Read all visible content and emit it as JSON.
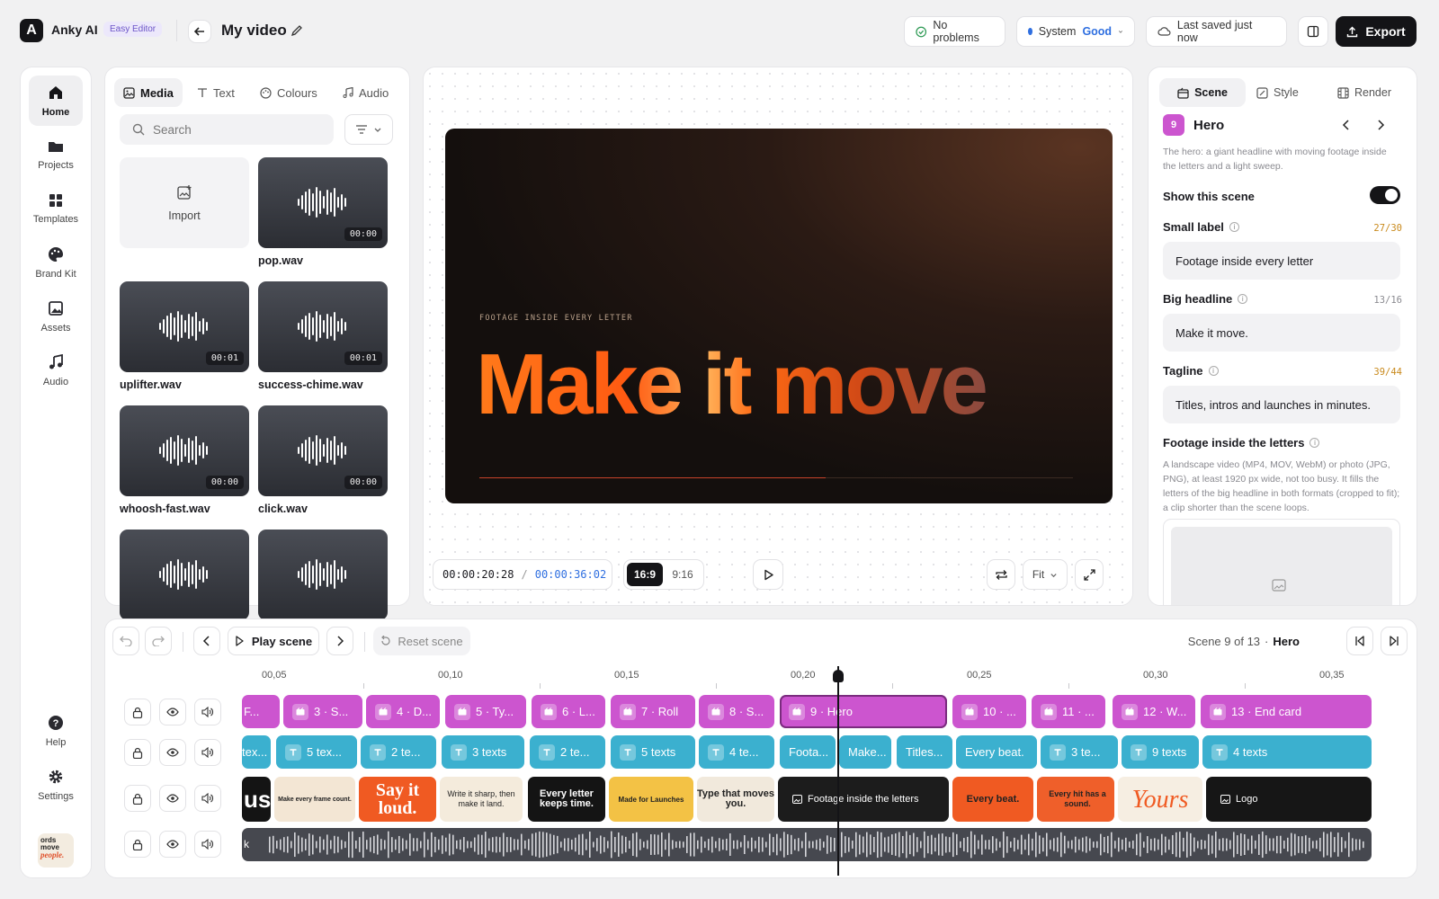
{
  "header": {
    "app_name": "Anky AI",
    "mode_badge": "Easy Editor",
    "video_title": "My video",
    "problems": "No problems",
    "system_label": "System",
    "system_status": "Good",
    "saved": "Last saved just now",
    "export": "Export",
    "accent": "#141417"
  },
  "sidebar": {
    "items": [
      {
        "label": "Home",
        "icon": "home-icon"
      },
      {
        "label": "Projects",
        "icon": "folder-icon"
      },
      {
        "label": "Templates",
        "icon": "grid-icon"
      },
      {
        "label": "Brand Kit",
        "icon": "palette-icon"
      },
      {
        "label": "Assets",
        "icon": "image-icon"
      },
      {
        "label": "Audio",
        "icon": "music-icon"
      }
    ],
    "help": "Help",
    "settings": "Settings",
    "avatar_text": [
      "ords",
      "move",
      "people."
    ]
  },
  "media": {
    "tabs": [
      "Media",
      "Text",
      "Colours",
      "Audio"
    ],
    "search_placeholder": "Search",
    "import": "Import",
    "files": [
      {
        "name": "pop.wav",
        "duration": "00:00"
      },
      {
        "name": "uplifter.wav",
        "duration": "00:01"
      },
      {
        "name": "success-chime.wav",
        "duration": "00:01"
      },
      {
        "name": "whoosh-fast.wav",
        "duration": "00:00"
      },
      {
        "name": "click.wav",
        "duration": "00:00"
      }
    ]
  },
  "preview": {
    "small_label": "FOOTAGE INSIDE EVERY LETTER",
    "headline": "Make it move",
    "current_time": "00:00:20:28",
    "total_time": "00:00:36:02",
    "ratios": [
      "16:9",
      "9:16"
    ],
    "fit": "Fit"
  },
  "inspector": {
    "tabs": [
      "Scene",
      "Style",
      "Render"
    ],
    "scene_number": "9",
    "scene_name": "Hero",
    "scene_desc": "The hero: a giant headline with moving footage inside the letters and a light sweep.",
    "show_scene": "Show this scene",
    "fields": [
      {
        "label": "Small label",
        "count": "27/30",
        "value": "Footage inside every letter",
        "count_color": "#c98a1d"
      },
      {
        "label": "Big headline",
        "count": "13/16",
        "value": "Make it move.",
        "count_color": "#8a8a90"
      },
      {
        "label": "Tagline",
        "count": "39/44",
        "value": "Titles, intros and launches in minutes.",
        "count_color": "#c98a1d"
      }
    ],
    "footage_label": "Footage inside the letters",
    "footage_desc": "A landscape video (MP4, MOV, WebM) or photo (JPG, PNG), at least 1920 px wide, not too busy. It fills the letters of the big headline in both formats (cropped to fit); a clip shorter than the scene loops."
  },
  "timeline": {
    "play_scene": "Play scene",
    "reset_scene": "Reset scene",
    "scene_info": "Scene 9 of 13",
    "scene_name": "Hero",
    "ticks": [
      "00,05",
      "00,10",
      "00,15",
      "00,20",
      "00,25",
      "00,30",
      "00,35"
    ],
    "scene_clips": [
      "F...",
      "3 · S...",
      "4 · D...",
      "5 · Ty...",
      "6 · L...",
      "7 · Roll",
      "8 · S...",
      "9 · Hero",
      "10 · ...",
      "11 · ...",
      "12 · W...",
      "13 · End card"
    ],
    "text_clips": [
      "tex...",
      "5 tex...",
      "2 te...",
      "3 texts",
      "2 te...",
      "5 texts",
      "4 te...",
      "Foota...",
      "Make...",
      "Titles...",
      "Every beat.",
      "3 te...",
      "9 texts",
      "4 texts"
    ],
    "thumbs": [
      "us",
      "Make every frame count.",
      "Say it loud.",
      "Write it sharp, then make it land.",
      "Every letter keeps time.",
      "Made for Launches",
      "Type that moves you.",
      "Footage inside the letters",
      "Every beat.",
      "Every hit has a sound.",
      "Yours",
      "Logo"
    ],
    "audio_label": "k"
  }
}
